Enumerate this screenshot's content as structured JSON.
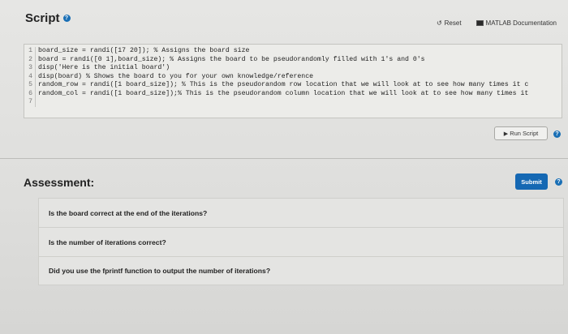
{
  "header": {
    "title": "Script"
  },
  "actions": {
    "reset_label": "Reset",
    "docs_label": "MATLAB Documentation"
  },
  "code": {
    "lines": [
      {
        "num": "1",
        "text": "board_size = randi([17 20]); % Assigns the board size"
      },
      {
        "num": "2",
        "text": "board = randi([0 1],board_size); % Assigns the board to be pseudorandomly filled with 1's and 0's"
      },
      {
        "num": "3",
        "text": "disp('Here is the initial board')"
      },
      {
        "num": "4",
        "text": "disp(board) % Shows the board to you for your own knowledge/reference"
      },
      {
        "num": "5",
        "text": "random_row = randi([1 board_size]); % This is the pseudorandom row location that we will look at to see how many times it c"
      },
      {
        "num": "6",
        "text": "random_col = randi([1 board_size]);% This is the pseudorandom column location that we will look at to see how many times it"
      },
      {
        "num": "7",
        "text": ""
      }
    ]
  },
  "run": {
    "label": "Run Script"
  },
  "assessment": {
    "title": "Assessment:",
    "submit_label": "Submit",
    "items": [
      "Is the board correct at the end of the iterations?",
      "Is the number of iterations correct?",
      "Did you use the fprintf function to output the number of iterations?"
    ]
  },
  "colors": {
    "accent": "#1568b3",
    "help_icon": "#1a6fb5"
  },
  "icons": {
    "help": "question-circle-icon",
    "reset": "reset-arrow-icon",
    "docs": "matlab-docs-icon",
    "run": "play-triangle-icon"
  }
}
